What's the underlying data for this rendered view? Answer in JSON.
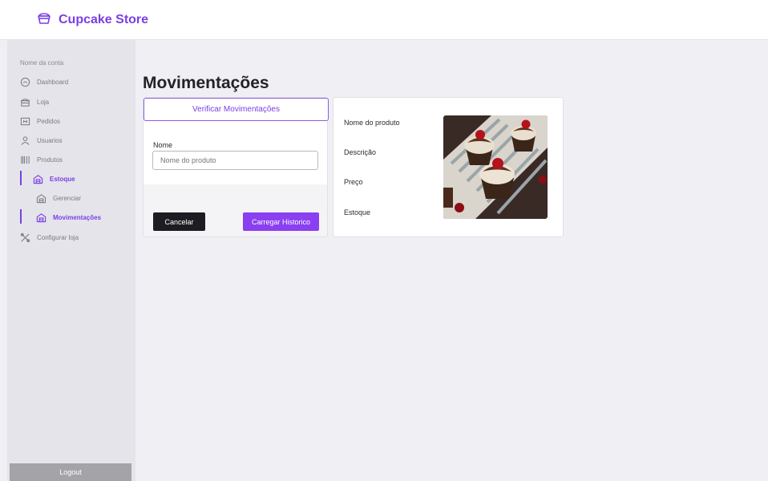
{
  "header": {
    "brand_name": "Cupcake Store",
    "brand_color": "#7b3fe4",
    "brand_icon": "cupcake-icon"
  },
  "sidebar": {
    "account_label": "Nome da conta",
    "items": [
      {
        "label": "Dashboard",
        "icon": "dashboard-icon"
      },
      {
        "label": "Loja",
        "icon": "store-icon"
      },
      {
        "label": "Pedidos",
        "icon": "orders-icon"
      },
      {
        "label": "Usuarios",
        "icon": "user-icon"
      },
      {
        "label": "Produtos",
        "icon": "products-icon"
      },
      {
        "label": "Estoque",
        "icon": "warehouse-icon",
        "active": true
      },
      {
        "label": "Gerenciar",
        "icon": "warehouse-icon"
      },
      {
        "label": "Movimentações",
        "icon": "warehouse-icon",
        "active": true
      },
      {
        "label": "Configurar loja",
        "icon": "tools-icon"
      }
    ],
    "logout_label": "Logout"
  },
  "main": {
    "title": "Movimentações",
    "form": {
      "tab_label": "Verificar Movimentações",
      "name_label": "Nome",
      "name_placeholder": "Nome do produto",
      "name_value": "",
      "cancel_label": "Cancelar",
      "load_label": "Carregar Historico"
    },
    "product": {
      "name_label": "Nome do produto",
      "description_label": "Descrição",
      "price_label": "Preço",
      "stock_label": "Estoque"
    }
  }
}
